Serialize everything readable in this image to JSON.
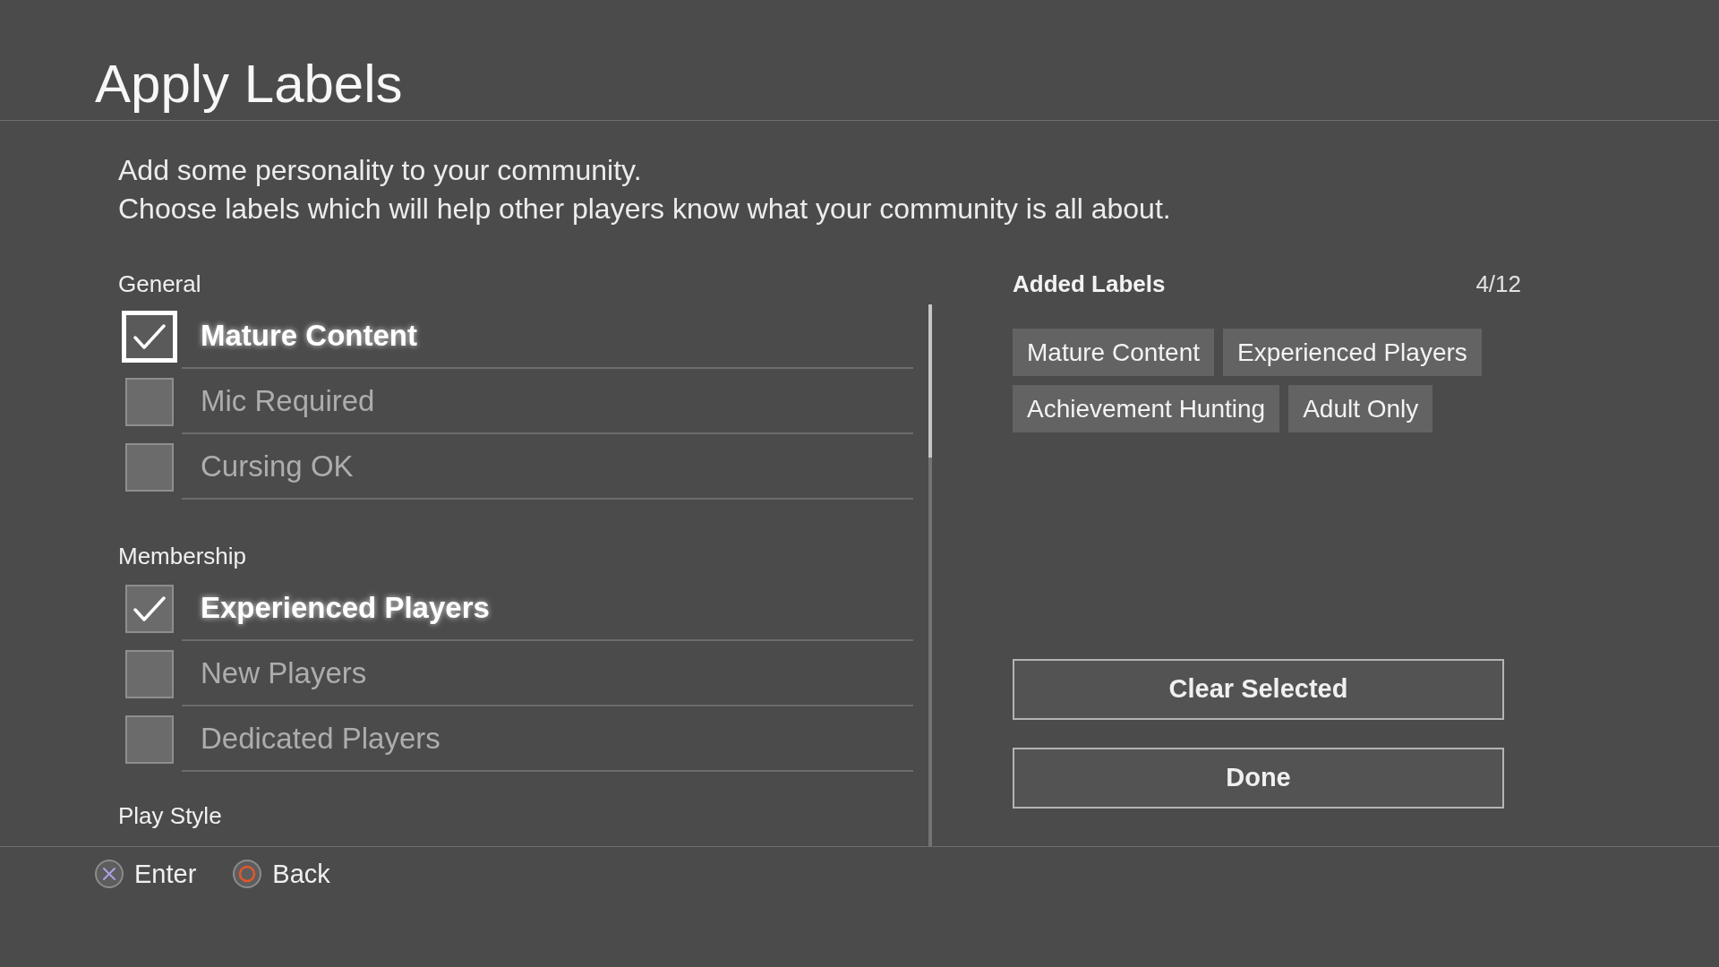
{
  "header": {
    "title": "Apply Labels"
  },
  "intro": [
    "Add some personality to your community.",
    "Choose labels which will help other players know what your community is all about."
  ],
  "label_groups": [
    {
      "heading": "General",
      "items": [
        {
          "label": "Mature Content",
          "checked": true,
          "focused": true
        },
        {
          "label": "Mic Required",
          "checked": false,
          "focused": false
        },
        {
          "label": "Cursing OK",
          "checked": false,
          "focused": false
        }
      ]
    },
    {
      "heading": "Membership",
      "items": [
        {
          "label": "Experienced Players",
          "checked": true,
          "focused": false
        },
        {
          "label": "New Players",
          "checked": false,
          "focused": false
        },
        {
          "label": "Dedicated Players",
          "checked": false,
          "focused": false
        }
      ]
    },
    {
      "heading": "Play Style"
    }
  ],
  "added_labels": {
    "heading": "Added Labels",
    "count": "4/12",
    "labels": [
      "Mature Content",
      "Experienced Players",
      "Achievement Hunting",
      "Adult Only"
    ]
  },
  "buttons": [
    "Clear Selected",
    "Done"
  ],
  "footer": {
    "hints": [
      {
        "kind": "cross",
        "label": "Enter"
      },
      {
        "kind": "circle",
        "label": "Back"
      }
    ]
  }
}
